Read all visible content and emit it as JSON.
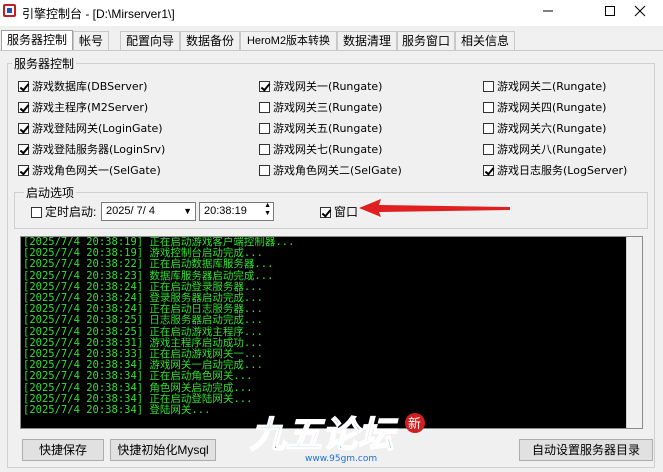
{
  "window": {
    "title": "引擎控制台 - [D:\\Mirserver1\\]"
  },
  "tabs": [
    "服务器控制",
    "帐号",
    "配置向导",
    "数据备份",
    "HeroM2版本转换",
    "数据清理",
    "服务窗口",
    "相关信息"
  ],
  "server_group": {
    "label": "服务器控制",
    "checkboxes": [
      {
        "label": "游戏数据库(DBServer)",
        "checked": true
      },
      {
        "label": "游戏网关一(Rungate)",
        "checked": true
      },
      {
        "label": "游戏网关二(Rungate)",
        "checked": false
      },
      {
        "label": "游戏主程序(M2Server)",
        "checked": true
      },
      {
        "label": "游戏网关三(Rungate)",
        "checked": false
      },
      {
        "label": "游戏网关四(Rungate)",
        "checked": false
      },
      {
        "label": "游戏登陆网关(LoginGate)",
        "checked": true
      },
      {
        "label": "游戏网关五(Rungate)",
        "checked": false
      },
      {
        "label": "游戏网关六(Rungate)",
        "checked": false
      },
      {
        "label": "游戏登陆服务器(LoginSrv)",
        "checked": true
      },
      {
        "label": "游戏网关七(Rungate)",
        "checked": false
      },
      {
        "label": "游戏网关八(Rungate)",
        "checked": false
      },
      {
        "label": "游戏角色网关一(SelGate)",
        "checked": true
      },
      {
        "label": "游戏角色网关二(SelGate)",
        "checked": false
      },
      {
        "label": "游戏日志服务(LogServer)",
        "checked": true
      }
    ]
  },
  "start_group": {
    "label": "启动选项",
    "timed_start_label": "定时启动:",
    "timed_start_checked": false,
    "date_value": "2025/ 7/ 4",
    "time_value": "20:38:19",
    "window_option_label": "窗口",
    "window_option_checked": true
  },
  "console": {
    "lines": [
      "[2025/7/4 20:38:19] 正在启动游戏客户端控制器...",
      "[2025/7/4 20:38:19] 游戏控制台启动完成...",
      "[2025/7/4 20:38:22] 正在启动数据库服务器...",
      "[2025/7/4 20:38:23] 数据库服务器启动完成...",
      "[2025/7/4 20:38:24] 正在启动登录服务器...",
      "[2025/7/4 20:38:24] 登录服务器启动完成...",
      "[2025/7/4 20:38:24] 正在启动日志服务器...",
      "[2025/7/4 20:38:25] 日志服务器启动完成...",
      "[2025/7/4 20:38:25] 正在启动游戏主程序...",
      "[2025/7/4 20:38:31] 游戏主程序启动成功...",
      "[2025/7/4 20:38:33] 正在启动游戏网关一...",
      "[2025/7/4 20:38:34] 游戏网关一启动完成...",
      "[2025/7/4 20:38:34] 正在启动角色网关...",
      "[2025/7/4 20:38:34] 角色网关启动完成...",
      "[2025/7/4 20:38:34] 正在启动登陆网关...",
      "[2025/7/4 20:38:34] 登陆网关..."
    ]
  },
  "buttons": {
    "quick_save": "快捷保存",
    "quick_init_mysql": "快捷初始化Mysql",
    "auto_set_dir": "自动设置服务器目录"
  },
  "watermark": {
    "text": "九五论坛",
    "badge": "新",
    "url": "www.95gm.com"
  },
  "colors": {
    "console_text": "#30e030",
    "console_bg": "#000000",
    "arrow": "#e02020"
  }
}
